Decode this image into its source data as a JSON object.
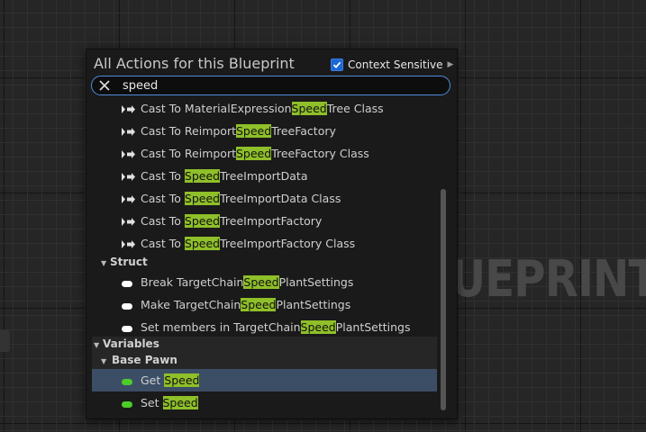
{
  "background": {
    "watermark": "UEPRINT"
  },
  "popup": {
    "title": "All Actions for this Blueprint",
    "context_sensitive": {
      "label": "Context Sensitive",
      "checked": true,
      "expand_arrow": "▶"
    },
    "search": {
      "value": "speed",
      "clear_icon": "close-icon"
    },
    "rows": [
      {
        "pre": "Cast To MaterialExpression",
        "hl": "Speed",
        "post": "Tree Class",
        "icon": "exec-arrow"
      },
      {
        "pre": "Cast To Reimport",
        "hl": "Speed",
        "post": "TreeFactory",
        "icon": "exec-arrow"
      },
      {
        "pre": "Cast To Reimport",
        "hl": "Speed",
        "post": "TreeFactory Class",
        "icon": "exec-arrow"
      },
      {
        "pre": "Cast To ",
        "hl": "Speed",
        "post": "TreeImportData",
        "icon": "exec-arrow"
      },
      {
        "pre": "Cast To ",
        "hl": "Speed",
        "post": "TreeImportData Class",
        "icon": "exec-arrow"
      },
      {
        "pre": "Cast To ",
        "hl": "Speed",
        "post": "TreeImportFactory",
        "icon": "exec-arrow"
      },
      {
        "pre": "Cast To ",
        "hl": "Speed",
        "post": "TreeImportFactory Class",
        "icon": "exec-arrow"
      }
    ],
    "struct_category": "Struct",
    "struct_rows": [
      {
        "pre": "Break TargetChain",
        "hl": "Speed",
        "post": "PlantSettings"
      },
      {
        "pre": "Make TargetChain",
        "hl": "Speed",
        "post": "PlantSettings"
      },
      {
        "pre": "Set members in TargetChain",
        "hl": "Speed",
        "post": "PlantSettings"
      }
    ],
    "variables_category": "Variables",
    "base_pawn_category": "Base Pawn",
    "variable_rows": [
      {
        "pre": "Get ",
        "hl": "Speed",
        "post": "",
        "selected": true
      },
      {
        "pre": "Set ",
        "hl": "Speed",
        "post": "",
        "selected": false
      }
    ]
  },
  "colors": {
    "highlight": "#8fbf29",
    "selected_row": "#3c4e66",
    "search_border": "#4f8edb",
    "checkbox": "#1b67d6",
    "variable_pin": "#4ccd2a"
  }
}
